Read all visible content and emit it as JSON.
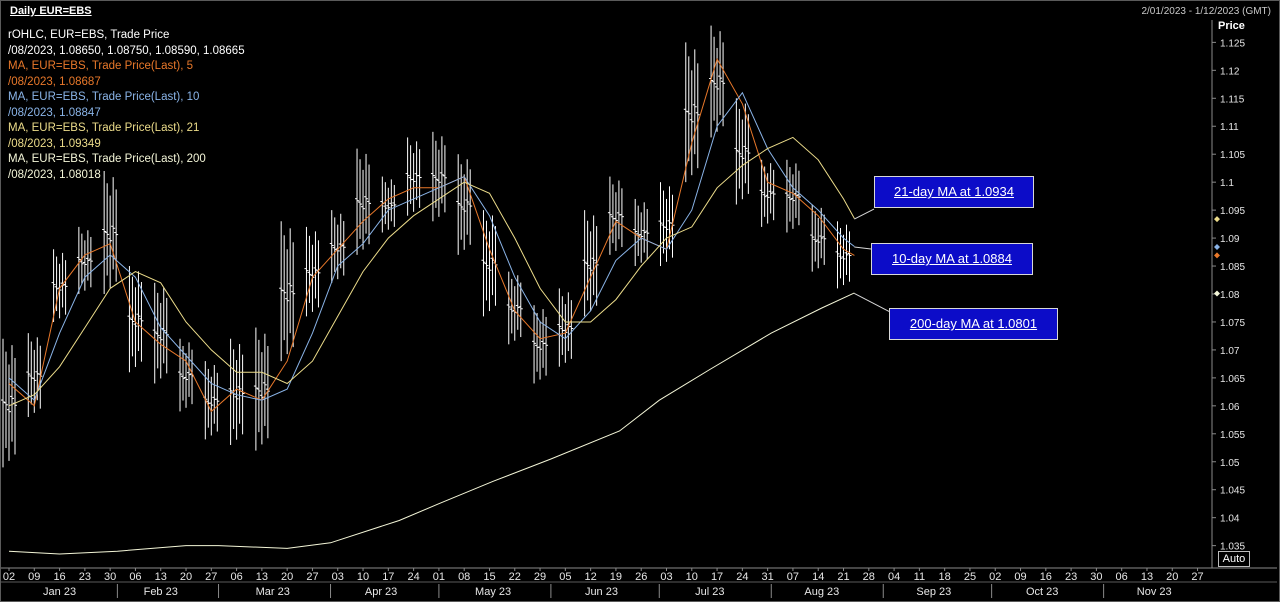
{
  "header": {
    "title": "Daily EUR=EBS",
    "date_range": "2/01/2023 - 1/12/2023 (GMT)"
  },
  "legend": [
    {
      "text": "rOHLC, EUR=EBS, Trade Price",
      "color": "#ffffff"
    },
    {
      "text": "/08/2023, 1.08650, 1.08750, 1.08590, 1.08665",
      "color": "#ffffff"
    },
    {
      "text": "MA, EUR=EBS, Trade Price(Last),  5",
      "color": "#e8782a"
    },
    {
      "text": "/08/2023, 1.08687",
      "color": "#e8782a"
    },
    {
      "text": "MA, EUR=EBS, Trade Price(Last),  10",
      "color": "#8ab4e8"
    },
    {
      "text": "/08/2023, 1.08847",
      "color": "#8ab4e8"
    },
    {
      "text": "MA, EUR=EBS, Trade Price(Last),  21",
      "color": "#ecdc8a"
    },
    {
      "text": "/08/2023, 1.09349",
      "color": "#ecdc8a"
    },
    {
      "text": "MA, EUR=EBS, Trade Price(Last),  200",
      "color": "#f4f6d8"
    },
    {
      "text": "/08/2023, 1.08018",
      "color": "#f4f6d8"
    }
  ],
  "axis": {
    "price_label": "Price",
    "auto_button": "Auto"
  },
  "callouts": {
    "ma21": "21-day MA at 1.0934",
    "ma10": "10-day MA at 1.0884",
    "ma200": "200-day MA at 1.0801"
  },
  "colors": {
    "ohlc": "#ffffff",
    "ma5": "#e8782a",
    "ma10": "#8ab4e8",
    "ma21": "#ecdc8a",
    "ma200": "#f4f6d8",
    "callout_bg": "#0c0cc8",
    "background": "#000000"
  },
  "chart_data": {
    "type": "line",
    "title": "Daily EUR=EBS",
    "ylabel": "Price",
    "ylim": [
      1.031,
      1.129
    ],
    "y_ticks": [
      1.035,
      1.04,
      1.045,
      1.05,
      1.055,
      1.06,
      1.065,
      1.07,
      1.075,
      1.08,
      1.085,
      1.09,
      1.095,
      1.1,
      1.105,
      1.11,
      1.115,
      1.12,
      1.125
    ],
    "y_tick_labels": [
      "1.035",
      "1.04",
      "1.045",
      "1.05",
      "1.055",
      "1.06",
      "1.065",
      "1.07",
      "1.075",
      "1.08",
      "1.085",
      "1.09",
      "1.095",
      "1.1",
      "1.105",
      "1.11",
      "1.115",
      "1.12",
      "1.125"
    ],
    "xlim": [
      "2023-01-02",
      "2023-12-01"
    ],
    "day_ticks": [
      {
        "date": "2023-01-02",
        "label": "02"
      },
      {
        "date": "2023-01-09",
        "label": "09"
      },
      {
        "date": "2023-01-16",
        "label": "16"
      },
      {
        "date": "2023-01-23",
        "label": "23"
      },
      {
        "date": "2023-01-30",
        "label": "30"
      },
      {
        "date": "2023-02-06",
        "label": "06"
      },
      {
        "date": "2023-02-13",
        "label": "13"
      },
      {
        "date": "2023-02-20",
        "label": "20"
      },
      {
        "date": "2023-02-27",
        "label": "27"
      },
      {
        "date": "2023-03-06",
        "label": "06"
      },
      {
        "date": "2023-03-13",
        "label": "13"
      },
      {
        "date": "2023-03-20",
        "label": "20"
      },
      {
        "date": "2023-03-27",
        "label": "27"
      },
      {
        "date": "2023-04-03",
        "label": "03"
      },
      {
        "date": "2023-04-10",
        "label": "10"
      },
      {
        "date": "2023-04-17",
        "label": "17"
      },
      {
        "date": "2023-04-24",
        "label": "24"
      },
      {
        "date": "2023-05-01",
        "label": "01"
      },
      {
        "date": "2023-05-08",
        "label": "08"
      },
      {
        "date": "2023-05-15",
        "label": "15"
      },
      {
        "date": "2023-05-22",
        "label": "22"
      },
      {
        "date": "2023-05-29",
        "label": "29"
      },
      {
        "date": "2023-06-05",
        "label": "05"
      },
      {
        "date": "2023-06-12",
        "label": "12"
      },
      {
        "date": "2023-06-19",
        "label": "19"
      },
      {
        "date": "2023-06-26",
        "label": "26"
      },
      {
        "date": "2023-07-03",
        "label": "03"
      },
      {
        "date": "2023-07-10",
        "label": "10"
      },
      {
        "date": "2023-07-17",
        "label": "17"
      },
      {
        "date": "2023-07-24",
        "label": "24"
      },
      {
        "date": "2023-07-31",
        "label": "31"
      },
      {
        "date": "2023-08-07",
        "label": "07"
      },
      {
        "date": "2023-08-14",
        "label": "14"
      },
      {
        "date": "2023-08-21",
        "label": "21"
      },
      {
        "date": "2023-08-28",
        "label": "28"
      },
      {
        "date": "2023-09-04",
        "label": "04"
      },
      {
        "date": "2023-09-11",
        "label": "11"
      },
      {
        "date": "2023-09-18",
        "label": "18"
      },
      {
        "date": "2023-09-25",
        "label": "25"
      },
      {
        "date": "2023-10-02",
        "label": "02"
      },
      {
        "date": "2023-10-09",
        "label": "09"
      },
      {
        "date": "2023-10-16",
        "label": "16"
      },
      {
        "date": "2023-10-23",
        "label": "23"
      },
      {
        "date": "2023-10-30",
        "label": "30"
      },
      {
        "date": "2023-11-06",
        "label": "06"
      },
      {
        "date": "2023-11-13",
        "label": "13"
      },
      {
        "date": "2023-11-20",
        "label": "20"
      },
      {
        "date": "2023-11-27",
        "label": "27"
      }
    ],
    "month_ticks": [
      {
        "date": "2023-01-16",
        "label": "Jan 23"
      },
      {
        "date": "2023-02-13",
        "label": "Feb 23"
      },
      {
        "date": "2023-03-16",
        "label": "Mar 23"
      },
      {
        "date": "2023-04-15",
        "label": "Apr 23"
      },
      {
        "date": "2023-05-16",
        "label": "May 23"
      },
      {
        "date": "2023-06-15",
        "label": "Jun 23"
      },
      {
        "date": "2023-07-15",
        "label": "Jul 23"
      },
      {
        "date": "2023-08-15",
        "label": "Aug 23"
      },
      {
        "date": "2023-09-15",
        "label": "Sep 23"
      },
      {
        "date": "2023-10-15",
        "label": "Oct 23"
      },
      {
        "date": "2023-11-15",
        "label": "Nov 23"
      }
    ],
    "month_separators": [
      "2023-02-01",
      "2023-03-01",
      "2023-04-01",
      "2023-05-01",
      "2023-06-01",
      "2023-07-01",
      "2023-08-01",
      "2023-09-01",
      "2023-10-01",
      "2023-11-01"
    ],
    "series": [
      {
        "name": "MA, EUR=EBS, Trade Price(Last),  5",
        "key": "ma5",
        "points": [
          [
            "2023-01-02",
            1.064
          ],
          [
            "2023-01-09",
            1.06
          ],
          [
            "2023-01-16",
            1.081
          ],
          [
            "2023-01-23",
            1.087
          ],
          [
            "2023-01-30",
            1.089
          ],
          [
            "2023-02-06",
            1.075
          ],
          [
            "2023-02-13",
            1.071
          ],
          [
            "2023-02-20",
            1.068
          ],
          [
            "2023-02-27",
            1.059
          ],
          [
            "2023-03-06",
            1.063
          ],
          [
            "2023-03-13",
            1.061
          ],
          [
            "2023-03-20",
            1.068
          ],
          [
            "2023-03-27",
            1.083
          ],
          [
            "2023-04-03",
            1.088
          ],
          [
            "2023-04-10",
            1.093
          ],
          [
            "2023-04-17",
            1.097
          ],
          [
            "2023-04-24",
            1.099
          ],
          [
            "2023-05-01",
            1.099
          ],
          [
            "2023-05-08",
            1.101
          ],
          [
            "2023-05-15",
            1.088
          ],
          [
            "2023-05-22",
            1.077
          ],
          [
            "2023-05-29",
            1.072
          ],
          [
            "2023-06-05",
            1.073
          ],
          [
            "2023-06-12",
            1.083
          ],
          [
            "2023-06-19",
            1.093
          ],
          [
            "2023-06-26",
            1.09
          ],
          [
            "2023-07-03",
            1.088
          ],
          [
            "2023-07-10",
            1.107
          ],
          [
            "2023-07-17",
            1.122
          ],
          [
            "2023-07-24",
            1.114
          ],
          [
            "2023-07-31",
            1.1
          ],
          [
            "2023-08-07",
            1.098
          ],
          [
            "2023-08-14",
            1.094
          ],
          [
            "2023-08-21",
            1.088
          ],
          [
            "2023-08-24",
            1.0869
          ]
        ]
      },
      {
        "name": "MA, EUR=EBS, Trade Price(Last),  10",
        "key": "ma10",
        "points": [
          [
            "2023-01-02",
            1.065
          ],
          [
            "2023-01-09",
            1.061
          ],
          [
            "2023-01-16",
            1.073
          ],
          [
            "2023-01-23",
            1.083
          ],
          [
            "2023-01-30",
            1.087
          ],
          [
            "2023-02-06",
            1.083
          ],
          [
            "2023-02-13",
            1.074
          ],
          [
            "2023-02-20",
            1.069
          ],
          [
            "2023-02-27",
            1.064
          ],
          [
            "2023-03-06",
            1.062
          ],
          [
            "2023-03-13",
            1.061
          ],
          [
            "2023-03-20",
            1.063
          ],
          [
            "2023-03-27",
            1.073
          ],
          [
            "2023-04-03",
            1.085
          ],
          [
            "2023-04-10",
            1.089
          ],
          [
            "2023-04-17",
            1.095
          ],
          [
            "2023-04-24",
            1.097
          ],
          [
            "2023-05-01",
            1.099
          ],
          [
            "2023-05-08",
            1.101
          ],
          [
            "2023-05-15",
            1.094
          ],
          [
            "2023-05-22",
            1.083
          ],
          [
            "2023-05-29",
            1.075
          ],
          [
            "2023-06-05",
            1.072
          ],
          [
            "2023-06-12",
            1.077
          ],
          [
            "2023-06-19",
            1.086
          ],
          [
            "2023-06-26",
            1.09
          ],
          [
            "2023-07-03",
            1.088
          ],
          [
            "2023-07-10",
            1.095
          ],
          [
            "2023-07-17",
            1.11
          ],
          [
            "2023-07-24",
            1.116
          ],
          [
            "2023-07-31",
            1.106
          ],
          [
            "2023-08-07",
            1.099
          ],
          [
            "2023-08-14",
            1.095
          ],
          [
            "2023-08-21",
            1.09
          ],
          [
            "2023-08-24",
            1.0885
          ]
        ]
      },
      {
        "name": "MA, EUR=EBS, Trade Price(Last),  21",
        "key": "ma21",
        "points": [
          [
            "2023-01-02",
            1.06
          ],
          [
            "2023-01-09",
            1.062
          ],
          [
            "2023-01-16",
            1.067
          ],
          [
            "2023-01-23",
            1.074
          ],
          [
            "2023-01-30",
            1.081
          ],
          [
            "2023-02-06",
            1.084
          ],
          [
            "2023-02-13",
            1.082
          ],
          [
            "2023-02-20",
            1.075
          ],
          [
            "2023-02-27",
            1.07
          ],
          [
            "2023-03-06",
            1.066
          ],
          [
            "2023-03-13",
            1.066
          ],
          [
            "2023-03-20",
            1.064
          ],
          [
            "2023-03-27",
            1.068
          ],
          [
            "2023-04-03",
            1.076
          ],
          [
            "2023-04-10",
            1.084
          ],
          [
            "2023-04-17",
            1.09
          ],
          [
            "2023-04-24",
            1.094
          ],
          [
            "2023-05-01",
            1.097
          ],
          [
            "2023-05-08",
            1.1
          ],
          [
            "2023-05-15",
            1.098
          ],
          [
            "2023-05-22",
            1.09
          ],
          [
            "2023-05-29",
            1.081
          ],
          [
            "2023-06-05",
            1.075
          ],
          [
            "2023-06-12",
            1.075
          ],
          [
            "2023-06-19",
            1.079
          ],
          [
            "2023-06-26",
            1.085
          ],
          [
            "2023-07-03",
            1.09
          ],
          [
            "2023-07-10",
            1.092
          ],
          [
            "2023-07-17",
            1.099
          ],
          [
            "2023-07-24",
            1.103
          ],
          [
            "2023-07-31",
            1.106
          ],
          [
            "2023-08-07",
            1.108
          ],
          [
            "2023-08-14",
            1.104
          ],
          [
            "2023-08-21",
            1.097
          ],
          [
            "2023-08-24",
            1.0935
          ]
        ]
      },
      {
        "name": "MA, EUR=EBS, Trade Price(Last),  200",
        "key": "ma200",
        "points": [
          [
            "2023-01-02",
            1.034
          ],
          [
            "2023-01-16",
            1.0335
          ],
          [
            "2023-02-01",
            1.034
          ],
          [
            "2023-02-20",
            1.035
          ],
          [
            "2023-03-01",
            1.035
          ],
          [
            "2023-03-20",
            1.0345
          ],
          [
            "2023-04-01",
            1.0355
          ],
          [
            "2023-04-20",
            1.0395
          ],
          [
            "2023-05-01",
            1.0425
          ],
          [
            "2023-05-16",
            1.0465
          ],
          [
            "2023-06-01",
            1.0505
          ],
          [
            "2023-06-20",
            1.0555
          ],
          [
            "2023-07-01",
            1.061
          ],
          [
            "2023-07-15",
            1.0665
          ],
          [
            "2023-08-01",
            1.073
          ],
          [
            "2023-08-15",
            1.0775
          ],
          [
            "2023-08-24",
            1.0802
          ]
        ]
      }
    ],
    "ohlc_weekly": [
      {
        "date": "2023-01-02",
        "high": 1.072,
        "low": 1.049
      },
      {
        "date": "2023-01-09",
        "high": 1.073,
        "low": 1.058
      },
      {
        "date": "2023-01-16",
        "high": 1.088,
        "low": 1.075
      },
      {
        "date": "2023-01-23",
        "high": 1.092,
        "low": 1.08
      },
      {
        "date": "2023-01-30",
        "high": 1.102,
        "low": 1.08
      },
      {
        "date": "2023-02-06",
        "high": 1.085,
        "low": 1.066
      },
      {
        "date": "2023-02-13",
        "high": 1.082,
        "low": 1.064
      },
      {
        "date": "2023-02-20",
        "high": 1.072,
        "low": 1.059
      },
      {
        "date": "2023-02-27",
        "high": 1.068,
        "low": 1.054
      },
      {
        "date": "2023-03-06",
        "high": 1.072,
        "low": 1.053
      },
      {
        "date": "2023-03-13",
        "high": 1.074,
        "low": 1.052
      },
      {
        "date": "2023-03-20",
        "high": 1.093,
        "low": 1.068
      },
      {
        "date": "2023-03-27",
        "high": 1.092,
        "low": 1.076
      },
      {
        "date": "2023-04-03",
        "high": 1.095,
        "low": 1.082
      },
      {
        "date": "2023-04-10",
        "high": 1.106,
        "low": 1.087
      },
      {
        "date": "2023-04-17",
        "high": 1.101,
        "low": 1.091
      },
      {
        "date": "2023-04-24",
        "high": 1.108,
        "low": 1.094
      },
      {
        "date": "2023-05-01",
        "high": 1.109,
        "low": 1.093
      },
      {
        "date": "2023-05-08",
        "high": 1.105,
        "low": 1.087
      },
      {
        "date": "2023-05-15",
        "high": 1.095,
        "low": 1.076
      },
      {
        "date": "2023-05-22",
        "high": 1.084,
        "low": 1.071
      },
      {
        "date": "2023-05-29",
        "high": 1.078,
        "low": 1.064
      },
      {
        "date": "2023-06-05",
        "high": 1.081,
        "low": 1.067
      },
      {
        "date": "2023-06-12",
        "high": 1.095,
        "low": 1.076
      },
      {
        "date": "2023-06-19",
        "high": 1.101,
        "low": 1.087
      },
      {
        "date": "2023-06-26",
        "high": 1.097,
        "low": 1.085
      },
      {
        "date": "2023-07-03",
        "high": 1.1,
        "low": 1.085
      },
      {
        "date": "2023-07-10",
        "high": 1.125,
        "low": 1.1
      },
      {
        "date": "2023-07-17",
        "high": 1.128,
        "low": 1.108
      },
      {
        "date": "2023-07-24",
        "high": 1.115,
        "low": 1.096
      },
      {
        "date": "2023-07-31",
        "high": 1.104,
        "low": 1.092
      },
      {
        "date": "2023-08-07",
        "high": 1.104,
        "low": 1.091
      },
      {
        "date": "2023-08-14",
        "high": 1.096,
        "low": 1.084
      },
      {
        "date": "2023-08-21",
        "high": 1.093,
        "low": 1.081
      }
    ],
    "last_markers": [
      {
        "series": "ma21",
        "value": 1.0934
      },
      {
        "series": "ma10",
        "value": 1.0884
      },
      {
        "series": "ma5",
        "value": 1.0869
      },
      {
        "series": "ma200",
        "value": 1.0801
      }
    ]
  }
}
